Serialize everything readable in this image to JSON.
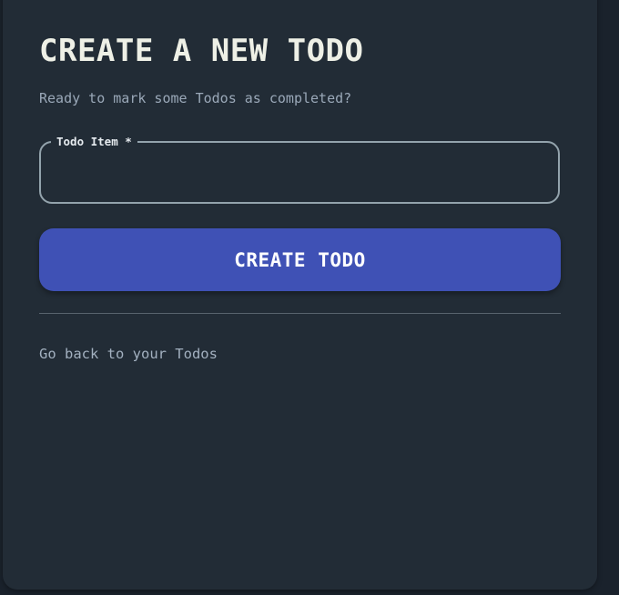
{
  "form": {
    "title": "CREATE A NEW TODO",
    "subtitle": "Ready to mark some Todos as completed?",
    "todo_field": {
      "label": "Todo Item *",
      "value": "",
      "placeholder": ""
    },
    "submit_label": "CREATE TODO",
    "back_link": "Go back to your Todos"
  },
  "colors": {
    "page_background": "#1a222c",
    "card_background": "#222c36",
    "accent_button": "#3f51b5",
    "title_text": "#eef0e6",
    "muted_text": "#9aa8b8",
    "field_border": "#93a3ac"
  }
}
